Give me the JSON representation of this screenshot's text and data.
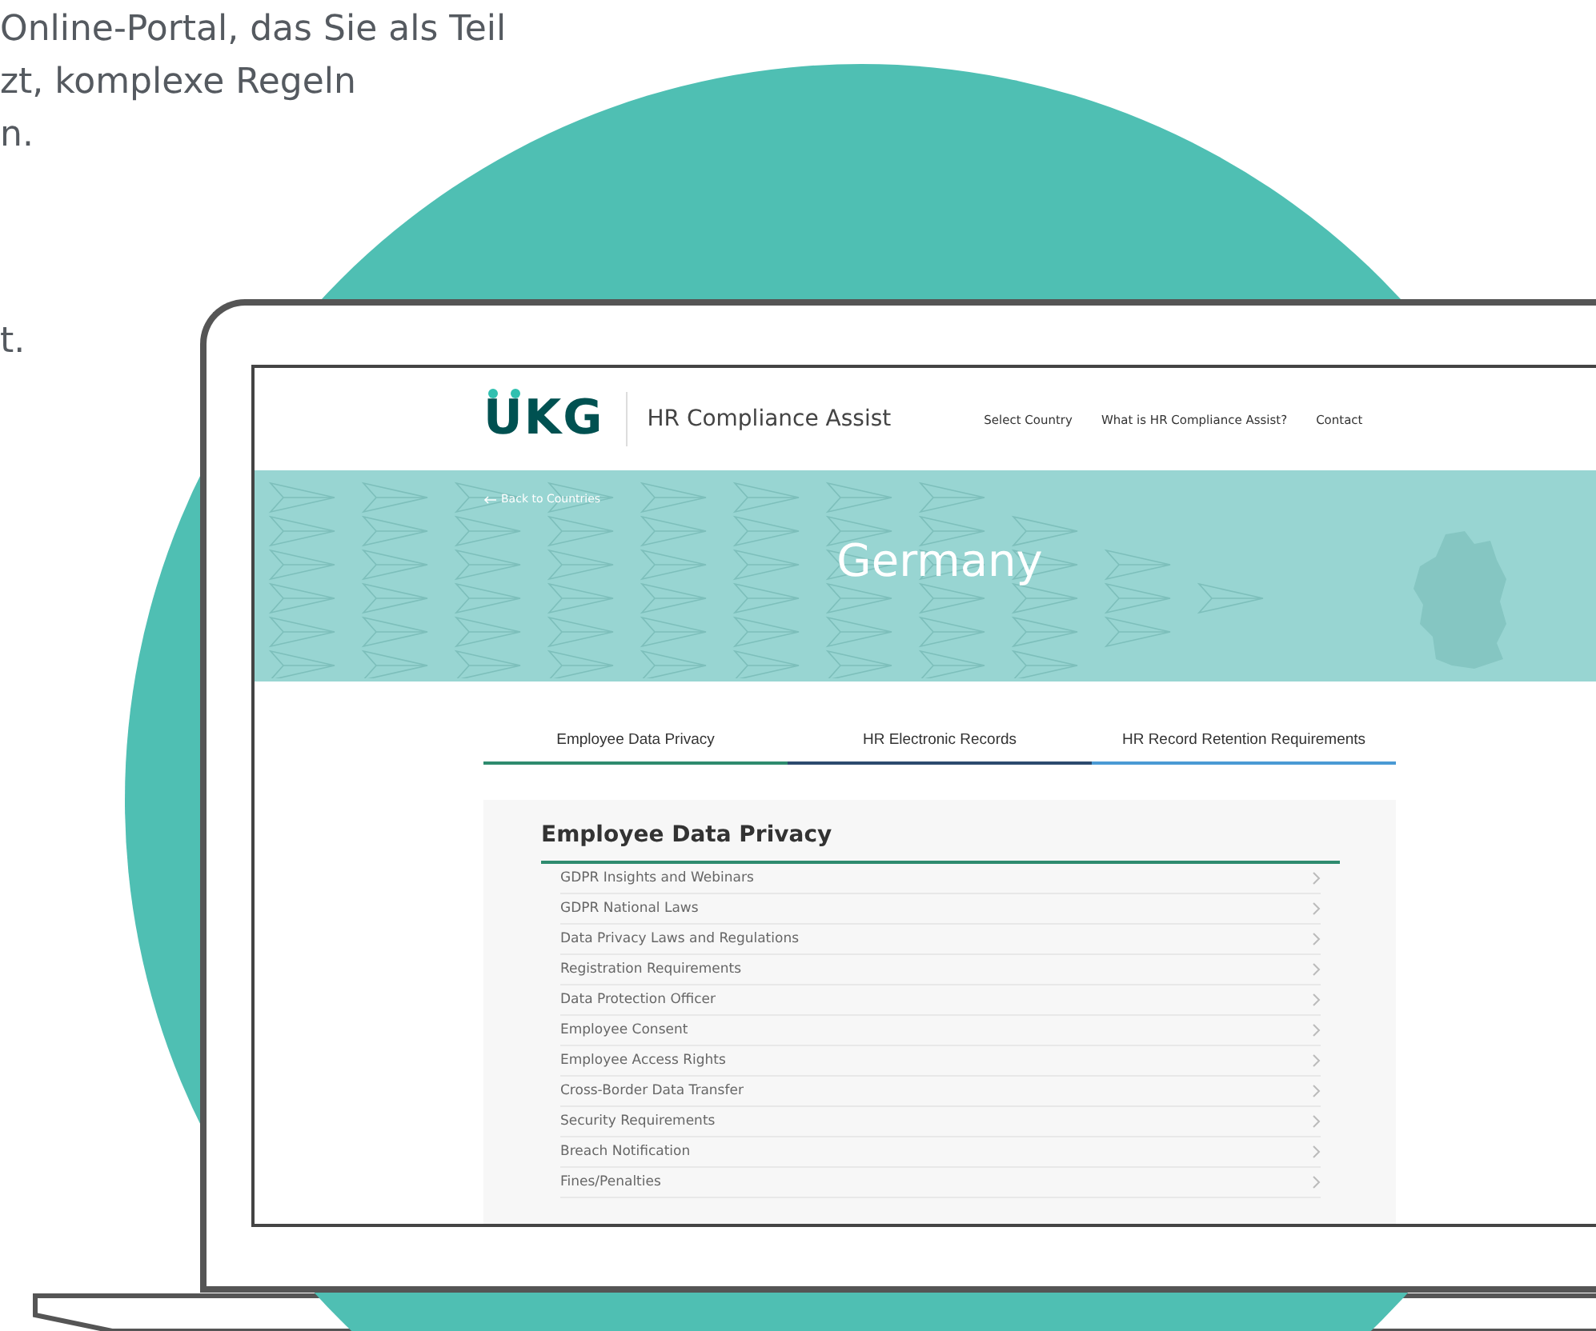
{
  "intro": {
    "lines": [
      "Online-Portal, das Sie als Teil",
      "zt, komplexe Regeln",
      "n."
    ],
    "side_fragment": "t."
  },
  "site": {
    "logo": "UKG",
    "title": "HR Compliance Assist",
    "nav": [
      "Select Country",
      "What is HR Compliance Assist?",
      "Contact"
    ],
    "hero": {
      "back_link": "Back to Countries",
      "country": "Germany"
    },
    "tabs": [
      {
        "label": "Employee Data Privacy",
        "color": "#2e8b6e"
      },
      {
        "label": "HR Electronic Records",
        "color": "#2c4a6e"
      },
      {
        "label": "HR Record Retention Requirements",
        "color": "#4a9ad4"
      }
    ],
    "panel": {
      "heading": "Employee Data Privacy",
      "items": [
        "GDPR Insights and Webinars",
        "GDPR National Laws",
        "Data Privacy Laws and Regulations",
        "Registration Requirements",
        "Data Protection Officer",
        "Employee Consent",
        "Employee Access Rights",
        "Cross-Border Data Transfer",
        "Security Requirements",
        "Breach Notification",
        "Fines/Penalties"
      ]
    }
  }
}
